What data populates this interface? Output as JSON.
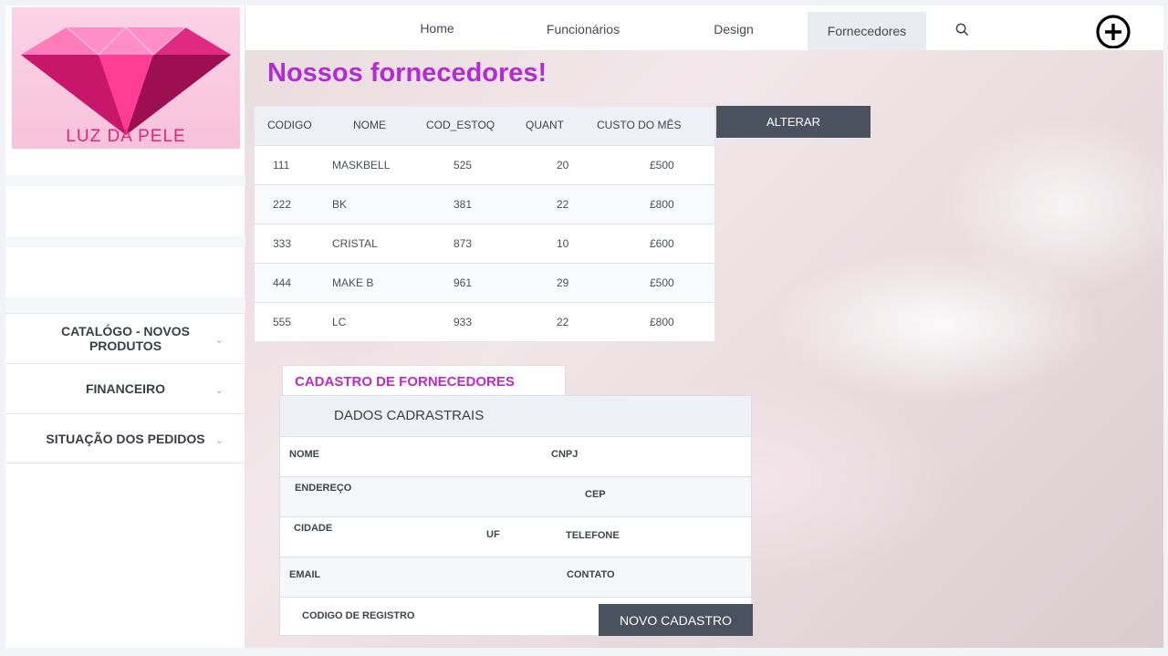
{
  "brand": {
    "logo_text": "LUZ DA PELE"
  },
  "sidebar": {
    "items": [
      {
        "label": "CATALÓGO - NOVOS PRODUTOS"
      },
      {
        "label": "FINANCEIRO"
      },
      {
        "label": "SITUAÇÃO DOS PEDIDOS"
      }
    ]
  },
  "nav": {
    "items": [
      {
        "label": "Home"
      },
      {
        "label": "Funcionários"
      },
      {
        "label": "Design"
      },
      {
        "label": "Fornecedores",
        "active": true
      }
    ]
  },
  "page": {
    "title": "Nossos fornecedores!"
  },
  "table": {
    "headers": [
      "CODIGO",
      "NOME",
      "COD_ESTOQ",
      "QUANT",
      "CUSTO DO MÊS"
    ],
    "rows": [
      [
        "111",
        "MASKBELL",
        "525",
        "20",
        "£500"
      ],
      [
        "222",
        "BK",
        "381",
        "22",
        "£800"
      ],
      [
        "333",
        "CRISTAL",
        "873",
        "10",
        "£600"
      ],
      [
        "444",
        "MAKE B",
        "961",
        "29",
        "£500"
      ],
      [
        "555",
        "LC",
        "933",
        "22",
        "£800"
      ]
    ]
  },
  "buttons": {
    "alterar": "ALTERAR",
    "novo_cadastro": "NOVO CADASTRO"
  },
  "form": {
    "tab": "CADASTRO DE FORNECEDORES",
    "header": "DADOS CADRASTRAIS",
    "labels": {
      "nome": "NOME",
      "cnpj": "CNPJ",
      "endereco": "ENDEREÇO",
      "cep": "CEP",
      "cidade": "CIDADE",
      "uf": "UF",
      "telefone": "TELEFONE",
      "email": "EMAIL",
      "contato": "CONTATO",
      "codigo_registro": "CODIGO DE REGISTRO"
    }
  },
  "colors": {
    "title": "#b42bd6",
    "form_tab": "#c128c9",
    "button": "#4a5260",
    "logo_text": "#e0267a"
  },
  "icons": {
    "search": "search-icon",
    "add": "plus-circle-icon",
    "chevron": "chevron-down-icon"
  }
}
